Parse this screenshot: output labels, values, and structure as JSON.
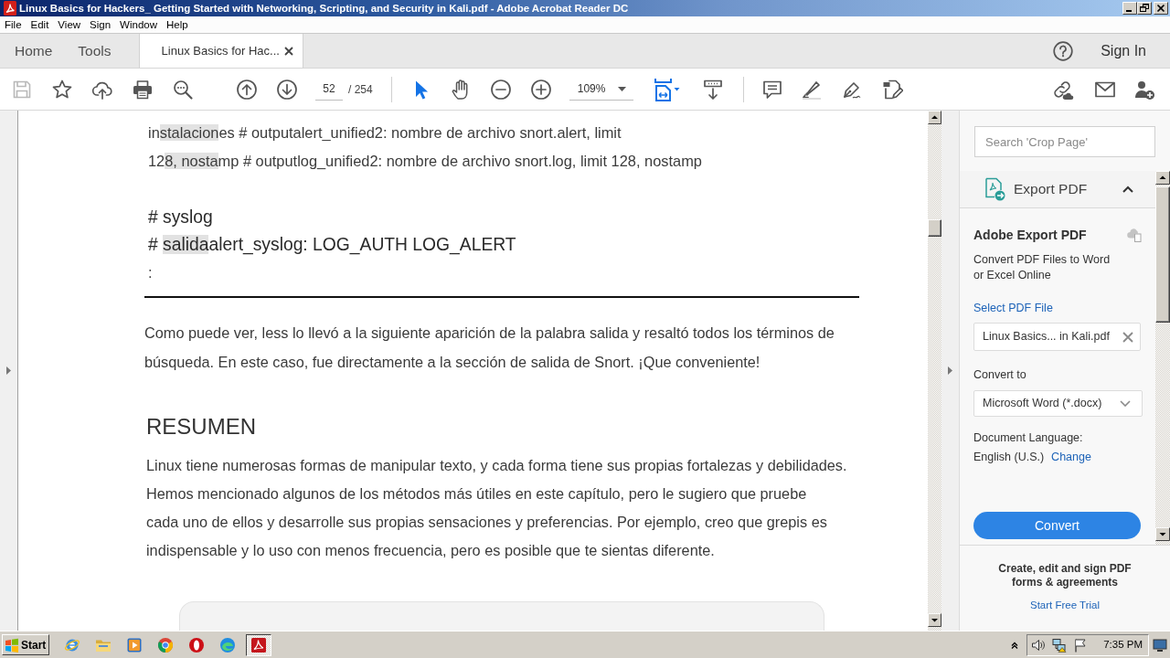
{
  "window": {
    "title": "Linux Basics for Hackers_ Getting Started with Networking, Scripting, and Security in Kali.pdf - Adobe Acrobat Reader DC"
  },
  "menu": [
    "File",
    "Edit",
    "View",
    "Sign",
    "Window",
    "Help"
  ],
  "tabs": [
    {
      "label": "Home",
      "kind": "view",
      "selected": false
    },
    {
      "label": "Tools",
      "kind": "view",
      "selected": false
    },
    {
      "label": "Linux Basics for Hac...",
      "kind": "document",
      "selected": true
    }
  ],
  "header": {
    "sign_in": "Sign In"
  },
  "toolbar": {
    "save": {
      "disabled": true
    },
    "page": "52",
    "page_total": "/ 254",
    "zoom": "109%"
  },
  "document": {
    "blocks": [
      {
        "kind": "listing",
        "lines": [
          {
            "segments": [
              {
                "text": "in",
                "highlighted": false
              },
              {
                "text": "stalacion",
                "highlighted": true
              },
              {
                "text": "es # outputalert_unified2: nombre de archivo snort.alert, limit",
                "highlighted": false
              }
            ]
          },
          {
            "segments": [
              {
                "text": "12",
                "highlighted": false
              },
              {
                "text": "8, nosta",
                "highlighted": true
              },
              {
                "text": "mp # outputlog_unified2: nombre de archivo snort.log, limit 128, nostamp",
                "highlighted": false
              }
            ]
          }
        ]
      },
      {
        "kind": "listing_large",
        "lines": [
          {
            "segments": [
              {
                "text": "# syslog",
                "highlighted": false
              }
            ]
          },
          {
            "segments": [
              {
                "text": "# ",
                "highlighted": false
              },
              {
                "text": "salida",
                "highlighted": true
              },
              {
                "text": "alert_syslog: LOG_AUTH LOG_ALERT",
                "highlighted": false
              }
            ]
          }
        ]
      },
      {
        "kind": "listing",
        "lines": [
          {
            "segments": [
              {
                "text": ":",
                "highlighted": false
              }
            ]
          }
        ]
      },
      {
        "kind": "rule"
      },
      {
        "kind": "paragraph",
        "lines": [
          "Como puede ver, less lo llevó a la siguiente aparición de la palabra salida y resaltó todos los términos de",
          "búsqueda. En este caso, fue directamente a la sección de salida de Snort. ¡Que conveniente!"
        ]
      },
      {
        "kind": "heading",
        "text": "RESUMEN"
      },
      {
        "kind": "paragraph",
        "lines": [
          "Linux tiene numerosas formas de manipular texto, y cada forma tiene sus propias fortalezas y debilidades.",
          "Hemos mencionado algunos de los métodos más útiles en este capítulo, pero le sugiero que pruebe",
          "cada uno de ellos y desarrolle sus propias sensaciones y preferencias. Por ejemplo, creo que grepis es",
          "indispensable y lo uso con menos frecuencia, pero es posible que te sientas diferente."
        ]
      },
      {
        "kind": "frame"
      }
    ]
  },
  "tools_pane": {
    "search": {
      "placeholder": "Search 'Crop Page'"
    },
    "section": {
      "title": "Export PDF",
      "expanded": true
    },
    "heading": "Adobe Export PDF",
    "description": "Convert PDF Files to Word or Excel Online",
    "file_label": "Select PDF File",
    "file": {
      "value": "Linux Basics... in Kali.pdf"
    },
    "format_label": "Convert to",
    "format": {
      "value": "Microsoft Word (*.docx)"
    },
    "language_label": "Document Language:",
    "language": "English (U.S.)",
    "language_link": "Change",
    "convert_button": "Convert",
    "promo": {
      "text": "Create, edit and sign PDF forms & agreements",
      "link": "Start Free Trial"
    }
  },
  "taskbar": {
    "start": "Start",
    "apps": [
      {
        "selected": false
      },
      {
        "selected": false
      },
      {
        "selected": false
      },
      {
        "selected": false
      },
      {
        "selected": false
      },
      {
        "selected": false
      },
      {
        "selected": true
      }
    ],
    "clock": "7:35 PM"
  }
}
